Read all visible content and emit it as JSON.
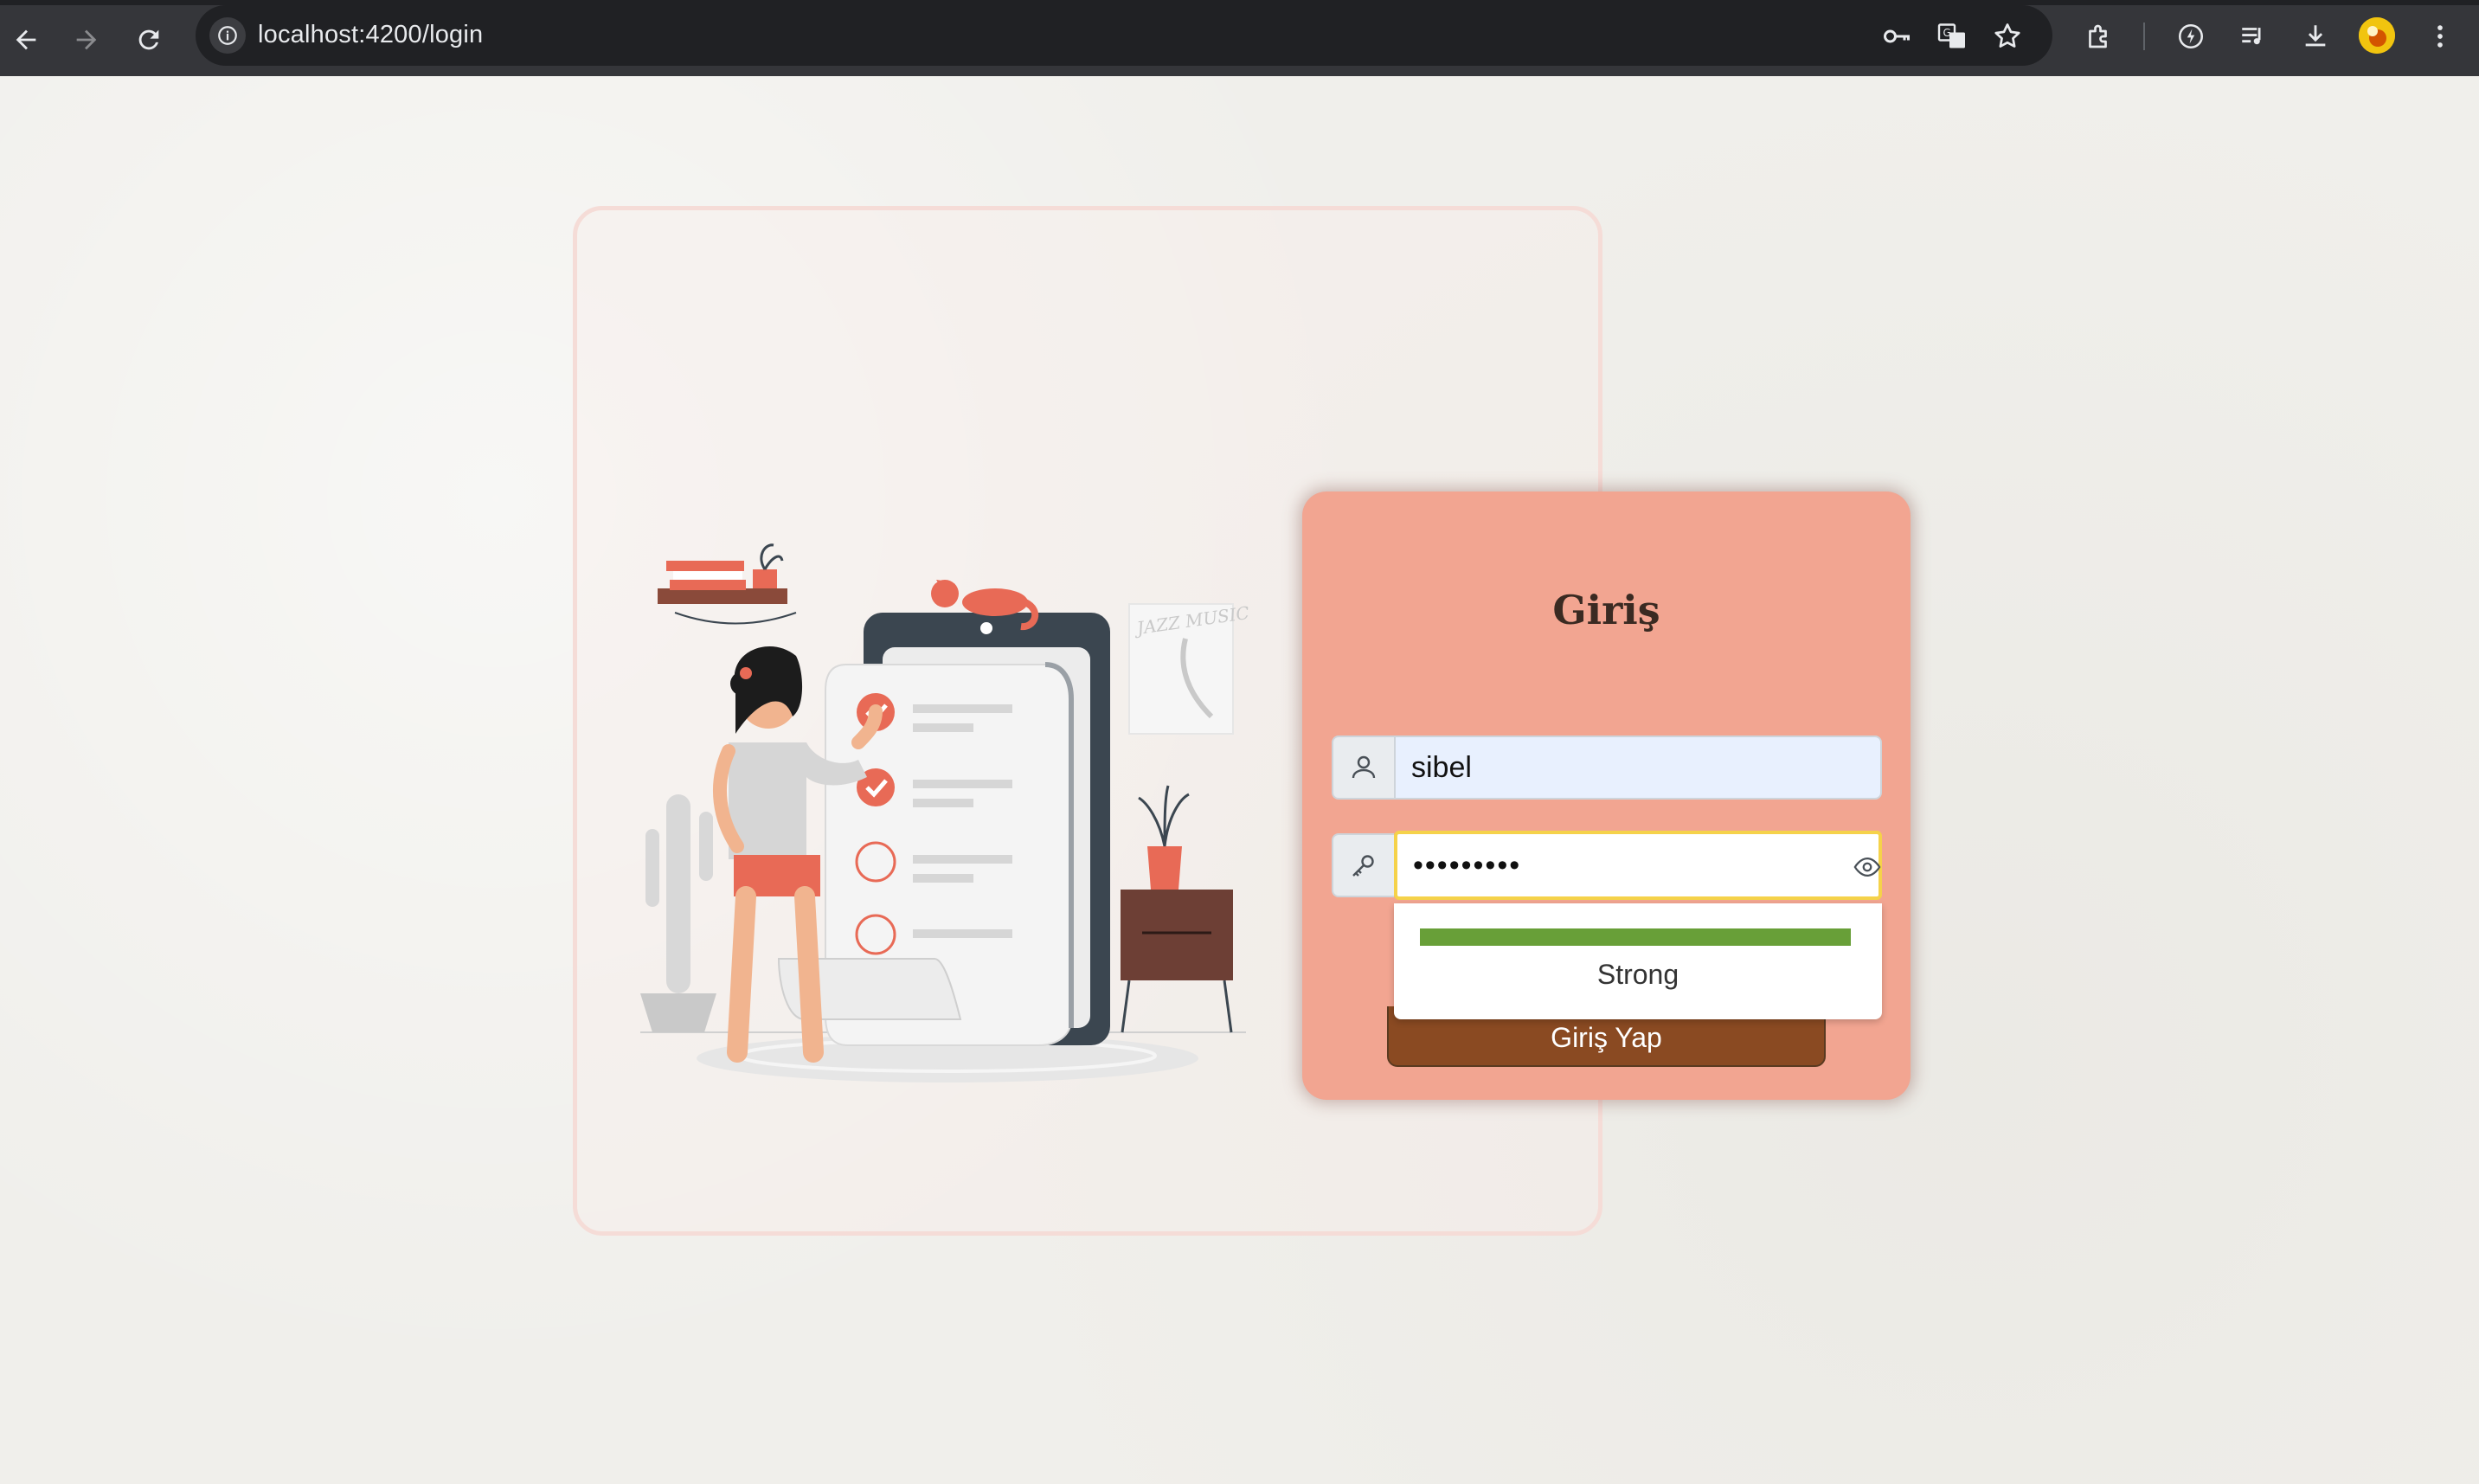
{
  "browser": {
    "url": "localhost:4200/login",
    "colors": {
      "toolbar": "#35363a",
      "omnibox": "#202124",
      "text": "#e8eaed"
    }
  },
  "login": {
    "title": "Giriş",
    "username_value": "sibel",
    "password_masked": "•••••••••",
    "strength_label": "Strong",
    "strength_fraction": 1.0,
    "submit_label": "Giriş Yap",
    "icons": {
      "user": "user-icon",
      "password": "key-icon",
      "toggle": "eye-icon"
    },
    "colors": {
      "card": "#f2a591",
      "button": "#8a4a22",
      "strength_bar": "#689f38",
      "focus_border": "#f5d24a",
      "autofill_bg": "#e8f0fe"
    }
  },
  "illustration": {
    "poster_text": "JAZZ MUSIC",
    "accent_color": "#e86a56"
  }
}
